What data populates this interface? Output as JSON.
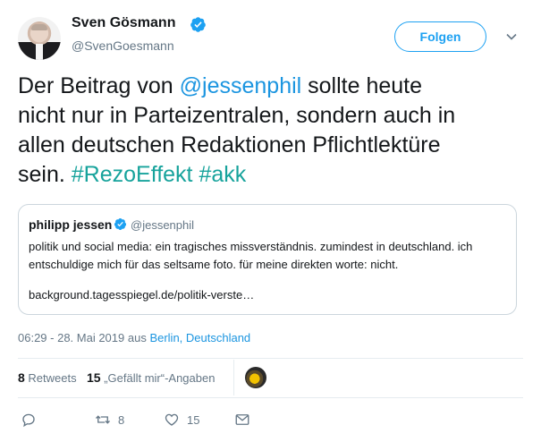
{
  "author": {
    "display_name": "Sven Gösmann",
    "handle": "@SvenGoesmann",
    "avatar_icon": "profile-photo",
    "verified_icon": "verified-badge-icon"
  },
  "follow_button": {
    "label": "Folgen"
  },
  "more_menu_icon": "chevron-down-icon",
  "tweet": {
    "line1_pre": "Der Beitrag von ",
    "line1_mention": "@jessenphil",
    "line1_post": " sollte heute",
    "line2": "nicht nur in Parteizentralen, sondern auch in",
    "line3": "allen deutschen Redaktionen Pflichtlektüre",
    "line4_pre": "sein. ",
    "hashtag1": "#RezoEffekt",
    "hashtag2": "#akk"
  },
  "quoted_tweet": {
    "name": "philipp jessen",
    "handle": "@jessenphil",
    "text_line1": "politik und social media: ein tragisches missverständnis. zumindest in deutschland. ich",
    "text_line2": "entschuldige mich für das seltsame foto. für meine direkten worte: nicht.",
    "link": "background.tagesspiegel.de/politik-verste…"
  },
  "meta": {
    "time": "06:29 - 28. Mai 2019 aus ",
    "location": "Berlin, Deutschland"
  },
  "stats": {
    "retweets_count": "8",
    "retweets_label": " Retweets",
    "likes_count": "15",
    "likes_label": " „Gefällt mir“-Angaben"
  },
  "actions": {
    "reply_count": "",
    "retweet_count": "8",
    "like_count": "15"
  },
  "colors": {
    "accent": "#1da1f2",
    "link": "#1b95e0",
    "hashtag": "#17a39c",
    "secondary_text": "#657786",
    "border": "#ccd6dd"
  }
}
